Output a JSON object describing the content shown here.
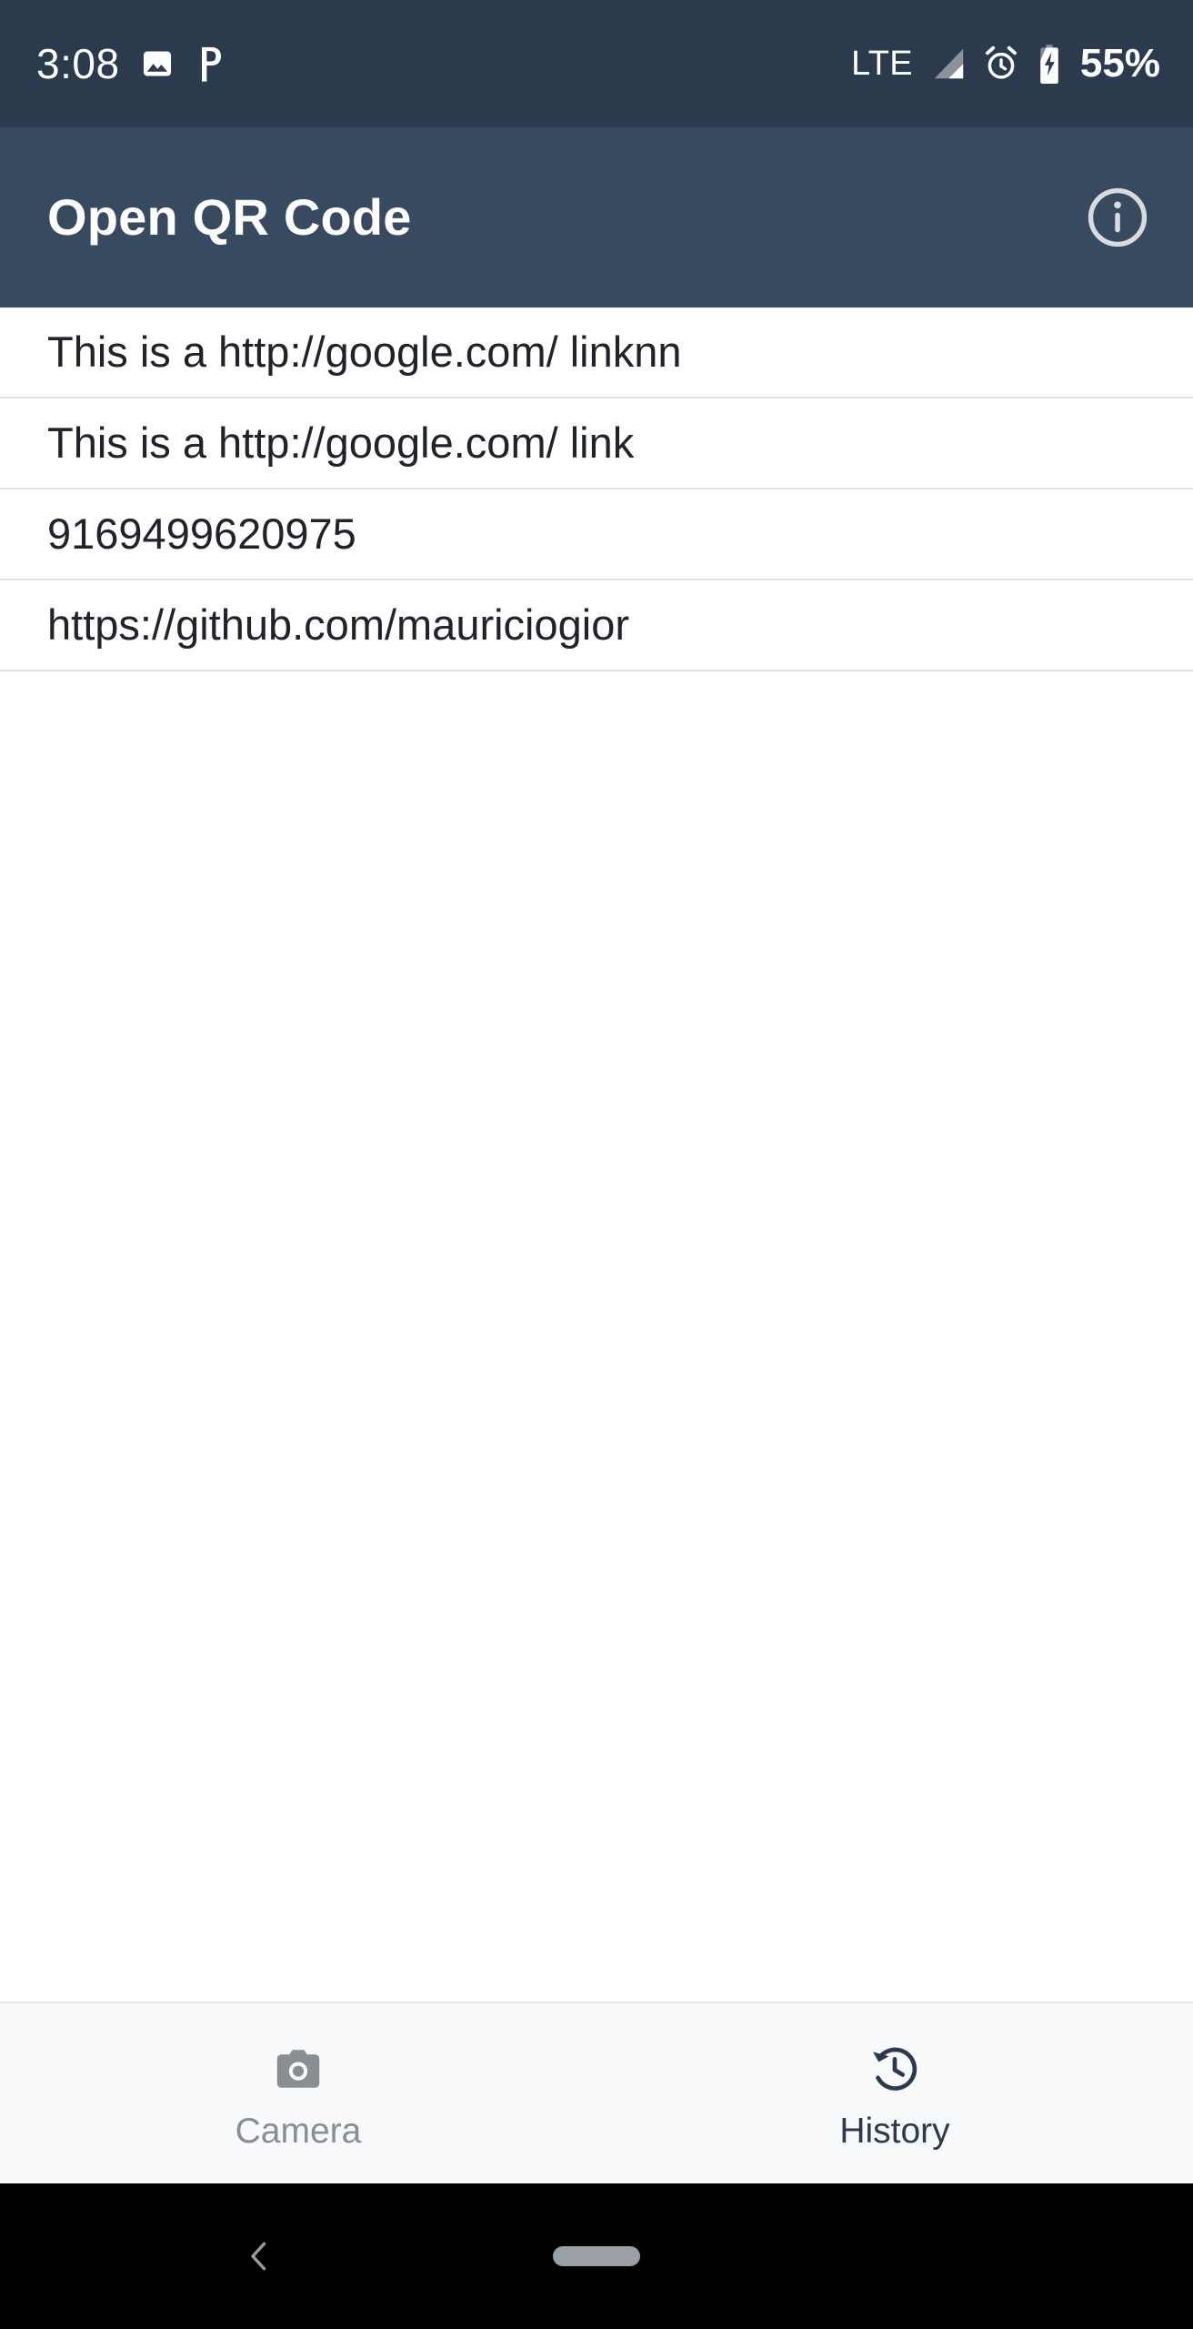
{
  "status_bar": {
    "time": "3:08",
    "left_icons": [
      "image-icon",
      "pocket-casts-icon"
    ],
    "network_label": "LTE",
    "right_icons": [
      "signal-icon",
      "alarm-icon",
      "battery-charging-icon"
    ],
    "battery_percent": "55%",
    "background_color": "#2C3A4E",
    "foreground_color": "#FFFFFF"
  },
  "app_bar": {
    "title": "Open QR Code",
    "info_icon": "info-icon",
    "background_color": "#374A60",
    "title_color": "#FFFFFF"
  },
  "history_list": {
    "items": [
      {
        "text": "This is a http://google.com/ linknn"
      },
      {
        "text": "This is a http://google.com/ link"
      },
      {
        "text": "9169499620975"
      },
      {
        "text": "https://github.com/mauriciogior"
      }
    ],
    "divider_color": "#E2E2E2",
    "text_color": "#20232A"
  },
  "bottom_nav": {
    "tabs": [
      {
        "label": "Camera",
        "icon": "camera-icon",
        "active": false,
        "color": "#8A8D91"
      },
      {
        "label": "History",
        "icon": "history-icon",
        "active": true,
        "color": "#2C3A4E"
      }
    ],
    "background_color": "#F8F9FA"
  },
  "system_nav": {
    "back_icon": "back-chevron-icon",
    "home_pill": "home-gesture-pill",
    "background_color": "#000000",
    "pill_color": "#9AA0A6"
  }
}
